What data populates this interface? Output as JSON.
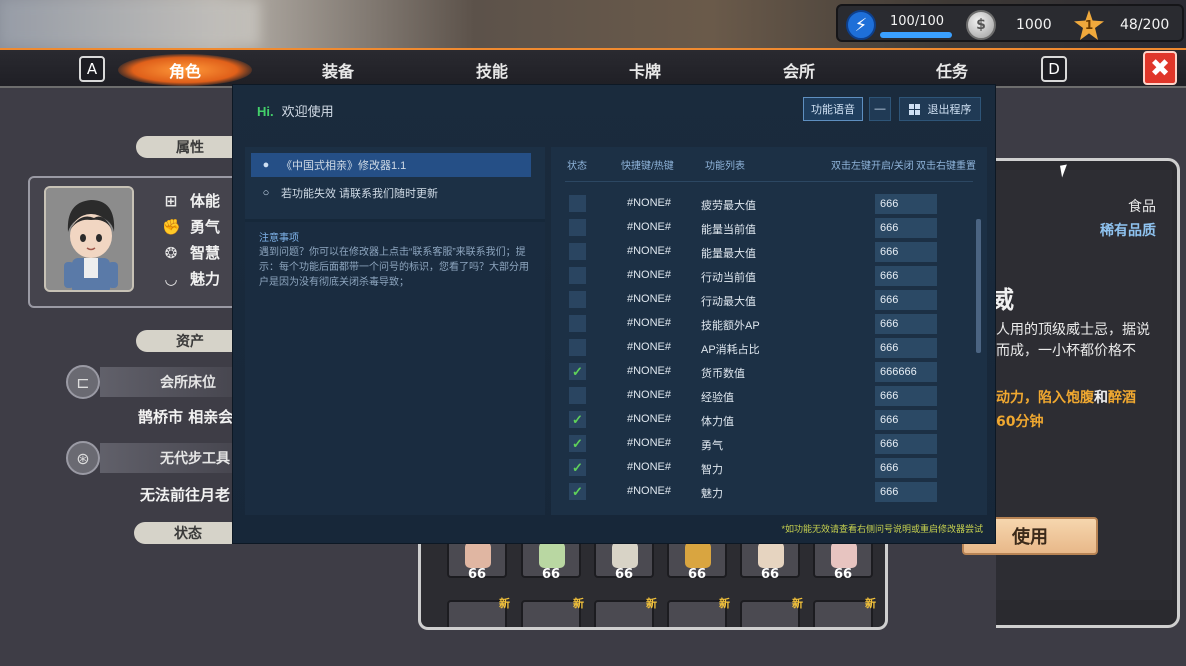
{
  "resources": {
    "energy": "100/100",
    "energy_fraction": 1.0,
    "coins": "1000",
    "level_badge": "1",
    "level_progress": "48/200"
  },
  "tabs": {
    "key_left": "A",
    "key_right": "D",
    "items": [
      "角色",
      "装备",
      "技能",
      "卡牌",
      "会所",
      "任务"
    ],
    "active_index": 0,
    "close_glyph": "✖"
  },
  "character": {
    "section_attributes": "属性",
    "stats": [
      {
        "label": "体能",
        "icon": "dumbbell-icon"
      },
      {
        "label": "勇气",
        "icon": "fist-icon"
      },
      {
        "label": "智慧",
        "icon": "brain-icon"
      },
      {
        "label": "魅力",
        "icon": "lips-icon"
      }
    ],
    "section_assets": "资产",
    "club_bed_label": "会所床位",
    "club_bed_value": "鹊桥市 相亲会",
    "transport_label": "无代步工具",
    "transport_value": "无法前往月老",
    "section_status": "状态"
  },
  "item_detail": {
    "type": "食品",
    "rarity": "稀有品质",
    "name_partial": "威",
    "desc_line1": "人用的顶级威士忌，据说",
    "desc_line2": "而成，一小杯都价格不",
    "effect_line1_a": "动力，陷入",
    "effect_line1_b": "饱腹",
    "effect_line1_c": "和",
    "effect_line1_d": "醉酒",
    "effect_line2": "60分钟",
    "use_button": "使用"
  },
  "inventory": {
    "counts": [
      "66",
      "66",
      "66",
      "66",
      "66",
      "66"
    ],
    "new_badge": "新"
  },
  "tool": {
    "hi": "Hi.",
    "welcome": "欢迎使用",
    "btn_voice": "功能语音",
    "btn_minimize": "—",
    "btn_exit": "退出程序",
    "trainer_name": "《中国式相亲》修改器1.1",
    "tip_row": "若功能失效  请联系我们随时更新",
    "notice_title": "注意事项",
    "notice_text": "遇到问题？你可以在修改器上点击“联系客服”来联系我们；提示：每个功能后面都带一个问号的标识，您看了吗？大部分用户是因为没有彻底关闭杀毒导致；",
    "col_status": "状态",
    "col_hotkey": "快捷键/热键",
    "col_function": "功能列表",
    "col_toggle_hint": "双击左键开启/关闭",
    "col_reset_hint": "双击右键重置",
    "rows": [
      {
        "checked": false,
        "hotkey": "#NONE#",
        "name": "疲劳最大值",
        "value": "666"
      },
      {
        "checked": false,
        "hotkey": "#NONE#",
        "name": "能量当前值",
        "value": "666"
      },
      {
        "checked": false,
        "hotkey": "#NONE#",
        "name": "能量最大值",
        "value": "666"
      },
      {
        "checked": false,
        "hotkey": "#NONE#",
        "name": "行动当前值",
        "value": "666"
      },
      {
        "checked": false,
        "hotkey": "#NONE#",
        "name": "行动最大值",
        "value": "666"
      },
      {
        "checked": false,
        "hotkey": "#NONE#",
        "name": "技能额外AP",
        "value": "666"
      },
      {
        "checked": false,
        "hotkey": "#NONE#",
        "name": "AP消耗占比",
        "value": "666"
      },
      {
        "checked": true,
        "hotkey": "#NONE#",
        "name": "货币数值",
        "value": "666666"
      },
      {
        "checked": false,
        "hotkey": "#NONE#",
        "name": "经验值",
        "value": "666"
      },
      {
        "checked": true,
        "hotkey": "#NONE#",
        "name": "体力值",
        "value": "666"
      },
      {
        "checked": true,
        "hotkey": "#NONE#",
        "name": "勇气",
        "value": "666"
      },
      {
        "checked": true,
        "hotkey": "#NONE#",
        "name": "智力",
        "value": "666"
      },
      {
        "checked": true,
        "hotkey": "#NONE#",
        "name": "魅力",
        "value": "666"
      }
    ],
    "footer": "*如功能无效请查看右侧问号说明或重启修改器尝试"
  }
}
